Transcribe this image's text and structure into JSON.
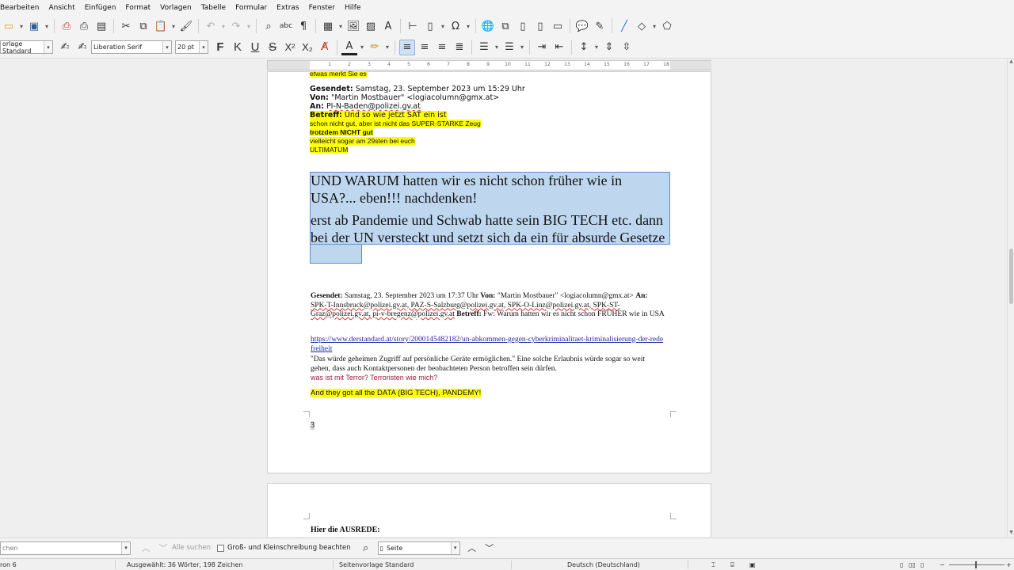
{
  "menu": [
    "Bearbeiten",
    "Ansicht",
    "Einfügen",
    "Format",
    "Vorlagen",
    "Tabelle",
    "Formular",
    "Extras",
    "Fenster",
    "Hilfe"
  ],
  "formatting": {
    "paragraph_style": "orlage Standard",
    "font_name": "Liberation Serif",
    "font_size": "20 pt",
    "bold_label": "F",
    "italic_label": "K",
    "underline_label": "U"
  },
  "ruler_numbers": [
    "1",
    "2",
    "3",
    "4",
    "5",
    "6",
    "7",
    "8",
    "9",
    "10",
    "11",
    "12",
    "13",
    "14",
    "15",
    "16",
    "17",
    "18"
  ],
  "document": {
    "top_partial": "etwas merkt Sie es",
    "email": {
      "sent_label": "Gesendet:",
      "sent_value": "Samstag, 23. September 2023 um 15:29 Uhr",
      "from_label": "Von:",
      "from_value": "\"Martin Mostbauer\" <logiacolumn@gmx.at>",
      "to_label": "An:",
      "to_value": "PI-N-Baden@polizei.gv.at",
      "subject_label": "Betreff:",
      "subject_value": "Und so wie jetzt SAT ein ist",
      "line2": "schon nicht gut, aber ist nicht das SUPER-STARKE Zeug",
      "line3": "trotzdem NICHT gut",
      "line4": "vielleicht sogar am 29sten bei euch",
      "line5": "ULTIMATUM"
    },
    "big_para1": "UND WARUM hatten wir es nicht schon früher wie in USA?... eben!!! nachdenken!",
    "big_para2": "erst ab Pandemie und Schwab hatte sein BIG TECH etc. dann bei der UN versteckt und setzt sich da ein für absurde Gesetze",
    "email2": {
      "sent_label": "Gesendet:",
      "sent_value": "Samstag, 23. September 2023 um 17:37 Uhr",
      "from_label": "Von:",
      "from_value": "\"Martin Mostbauer\" <logiacolumn@gmx.at>",
      "to_label": "An:",
      "to_value": "SPK-T-Innsbruck@polizei.gv.at, PAZ-S-Salzburg@polizei.gv.at, SPK-O-Linz@polizei.gv.at, SPK-ST-Graz@polizei.gv.at, pi-v-bregenz@polizei.gv.at",
      "subject_label": "Betreff:",
      "subject_value": "Fw: Warum hatten wir es nicht schon FRÜHER wie in USA"
    },
    "link": "https://www.derstandard.at/story/2000145482182/un-abkommen-gegen-cyberkriminalitaet-kriminalisierung-der-redefreiheit",
    "quote": "\"Das würde geheimen Zugriff auf persönliche Geräte ermöglichen.\" Eine solche Erlaubnis würde sogar so weit gehen, dass auch Kontaktpersonen der beobachteten Person betroffen sein dürfen.",
    "terror_line": "was ist mit Terror? Terroristen wie mich?",
    "bigtech_line": "And they got all the DATA (BIG TECH), PANDEMY!",
    "page_number": "3",
    "page2_heading": "Hier die AUSREDE:"
  },
  "findbar": {
    "search_value": "chen",
    "find_all": "Alle suchen",
    "match_case": "Groß- und Kleinschreibung beachten",
    "navigate_by": "Seite"
  },
  "status": {
    "page": "ron 6",
    "selection": "Ausgewählt: 36 Wörter, 198 Zeichen",
    "page_style": "Seitenvorlage Standard",
    "language": "Deutsch (Deutschland)"
  },
  "colors": {
    "highlight": "#ffff00",
    "selection": "#bed7ef",
    "link": "#1a2aa8",
    "terror_text": "#9a1a3a"
  }
}
